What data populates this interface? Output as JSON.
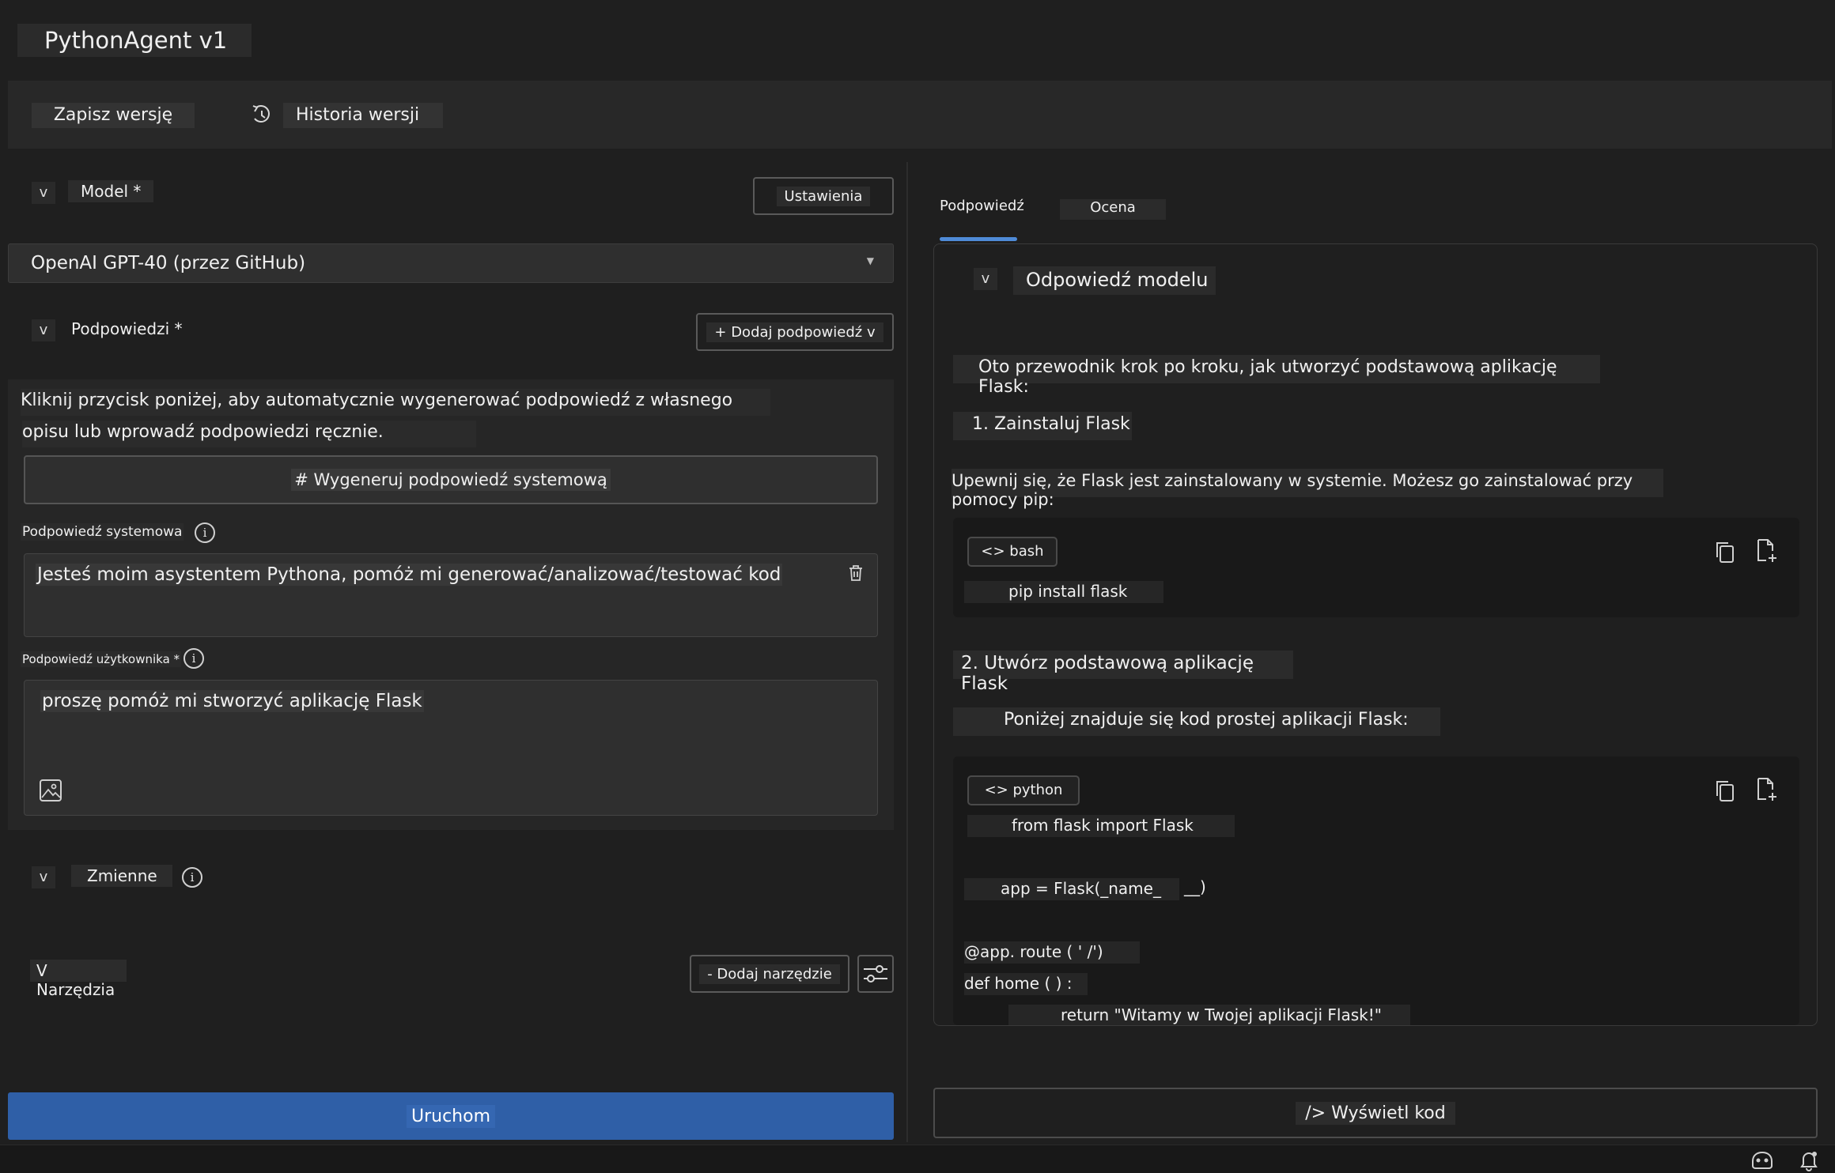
{
  "app": {
    "title": "PythonAgent v1"
  },
  "toolbar": {
    "save_label": "Zapisz wersję",
    "history_label": "Historia wersji"
  },
  "model_section": {
    "toggle": "v",
    "label": "Model *",
    "settings_label": "Ustawienia",
    "selected_model": "OpenAI GPT-40 (przez GitHub)"
  },
  "prompts_section": {
    "toggle": "v",
    "label": "Podpowiedzi *",
    "add_label": "+ Dodaj podpowiedź v",
    "hint_line1": "Kliknij przycisk poniżej, aby automatycznie wygenerować podpowiedź z własnego",
    "hint_line2": "opisu lub wprowadź podpowiedzi ręcznie.",
    "generate_label": "# Wygeneruj podpowiedź systemową",
    "system_label": "Podpowiedź systemowa",
    "system_value": "Jesteś moim asystentem Pythona, pomóż mi generować/analizować/testować kod",
    "user_label": "Podpowiedź użytkownika *",
    "user_value": "proszę pomóż mi stworzyć aplikację Flask"
  },
  "variables_section": {
    "toggle": "v",
    "label": "Zmienne"
  },
  "tools_section": {
    "label": "V Narzędzia",
    "add_label": "- Dodaj narzędzie"
  },
  "run_label": "Uruchom",
  "right": {
    "tabs": [
      "Podpowiedź",
      "Ocena"
    ],
    "response_toggle": "v",
    "response_title": "Odpowiedź modelu",
    "intro": "Oto przewodnik krok po kroku, jak utworzyć podstawową aplikację Flask:",
    "step1": "1. Zainstaluj Flask",
    "step1_text": "Upewnij się, że Flask jest zainstalowany w systemie. Możesz go zainstalować przy pomocy pip:",
    "bash_lang": "<> bash",
    "bash_code": "pip install flask",
    "step2": "2. Utwórz podstawową aplikację Flask",
    "step2_text": "Poniżej znajduje się kod prostej aplikacji Flask:",
    "python_lang": "<> python",
    "python_code": [
      "from flask import Flask",
      "app = Flask(_name_",
      "__)",
      "@app. route ( ' /')",
      "def home ( ) :",
      "return \"Witamy w Twojej aplikacji Flask!\""
    ],
    "view_code_label": "/> Wyświetl kod"
  }
}
